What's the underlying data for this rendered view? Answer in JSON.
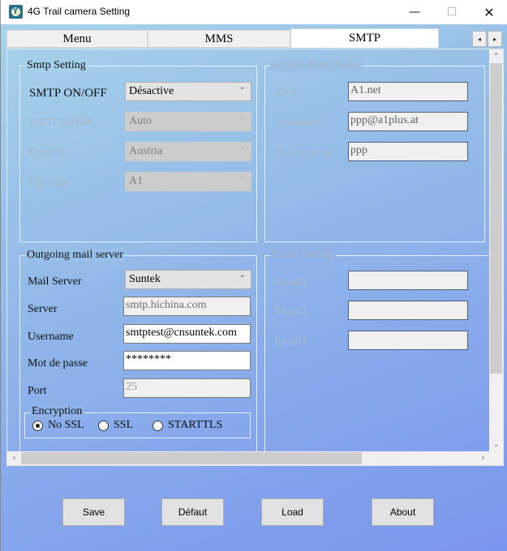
{
  "window": {
    "title": "4G Trail camera Setting",
    "controls": {
      "minimize": "—",
      "maximize": "☐",
      "close": "✕"
    }
  },
  "tabs": {
    "items": [
      {
        "label": "Menu",
        "active": false
      },
      {
        "label": "MMS",
        "active": false
      },
      {
        "label": "SMTP",
        "active": true
      }
    ],
    "scroll_left": "◂",
    "scroll_right": "▸"
  },
  "smtp_setting": {
    "title": "Smtp Setting",
    "on_off": {
      "label": "SMTP ON/OFF",
      "value": "Désactive"
    },
    "mode": {
      "label": "SMTP MODE",
      "value": "Auto",
      "disabled": true
    },
    "country": {
      "label": "Country",
      "value": "Austria",
      "disabled": true
    },
    "operator": {
      "label": "Operator",
      "value": "A1",
      "disabled": true
    }
  },
  "access_point": {
    "title": "Access Point Name",
    "apn": {
      "label": "APN",
      "value": "A1.net"
    },
    "username": {
      "label": "Username",
      "value": "ppp@a1plus.at"
    },
    "password": {
      "label": "Mot de passe",
      "value": "ppp"
    }
  },
  "outgoing": {
    "title": "Outgoing mail server",
    "mail_server": {
      "label": "Mail Server",
      "value": "Suntek"
    },
    "server": {
      "label": "Server",
      "value": "smtp.hichina.com"
    },
    "username": {
      "label": "Username",
      "value": "smtptest@cnsuntek.com"
    },
    "password": {
      "label": "Mot de passe",
      "value": "********"
    },
    "port": {
      "label": "Port",
      "value": "25"
    },
    "encryption": {
      "title": "Encryption",
      "options": [
        {
          "label": "No SSL",
          "selected": true
        },
        {
          "label": "SSL",
          "selected": false
        },
        {
          "label": "STARTTLS",
          "selected": false
        }
      ]
    }
  },
  "email_setting": {
    "title": "Email Setting",
    "email1": {
      "label": "Email1",
      "value": ""
    },
    "email2": {
      "label": "Email2",
      "value": ""
    },
    "email3": {
      "label": "Email3",
      "value": ""
    }
  },
  "scrollbars": {
    "up": "⌃",
    "down": "⌄",
    "left": "‹",
    "right": "›"
  },
  "chevron": "⌄",
  "buttons": {
    "save": "Save",
    "default": "Défaut",
    "load": "Load",
    "about": "About"
  }
}
